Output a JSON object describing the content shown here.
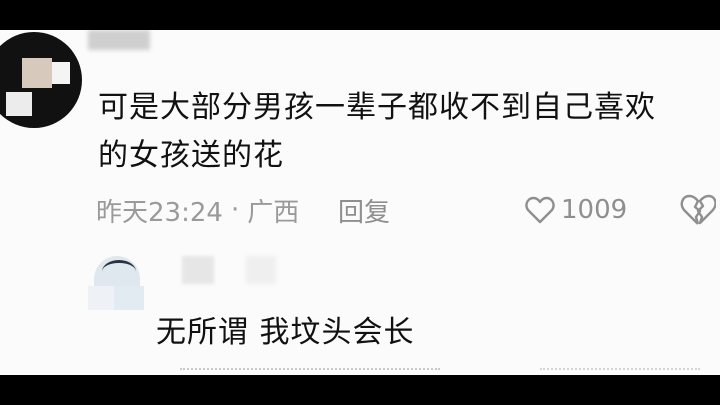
{
  "comment": {
    "text_line1": "可是大部分男孩一辈子都收不到自己喜欢",
    "text_line2": "的女孩送的花",
    "time": "昨天23:24",
    "separator": "·",
    "location": "广西",
    "reply_label": "回复",
    "like_count": "1009",
    "like_icon": "heart-outline-icon",
    "dislike_icon": "broken-heart-icon"
  },
  "reply": {
    "text": "无所谓 我坟头会长"
  },
  "colors": {
    "background": "#fbfbfb",
    "text": "#111111",
    "meta": "#9a9a9a",
    "letterbox": "#000000"
  }
}
